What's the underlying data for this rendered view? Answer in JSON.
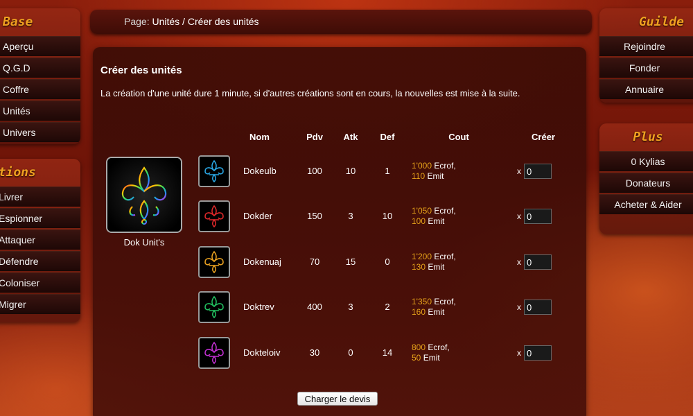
{
  "sidebar_left": {
    "base": {
      "title": "Base",
      "items": [
        {
          "label": "Aperçu"
        },
        {
          "label": "Q.G.D"
        },
        {
          "label": "Coffre"
        },
        {
          "label": "Unités"
        },
        {
          "label": "Univers"
        }
      ]
    },
    "actions": {
      "title": "Actions",
      "items": [
        {
          "label": "Livrer"
        },
        {
          "label": "Espionner"
        },
        {
          "label": "Attaquer"
        },
        {
          "label": "Défendre"
        },
        {
          "label": "Coloniser"
        },
        {
          "label": "Migrer"
        }
      ]
    }
  },
  "sidebar_right": {
    "guilde": {
      "title": "Guilde",
      "items": [
        {
          "label": "Rejoindre"
        },
        {
          "label": "Fonder"
        },
        {
          "label": "Annuaire"
        }
      ]
    },
    "plus": {
      "title": "Plus",
      "items": [
        {
          "label": "0 Kylias"
        },
        {
          "label": "Donateurs"
        },
        {
          "label": "Acheter & Aider"
        }
      ]
    }
  },
  "breadcrumb": {
    "label": "Page:",
    "path": "Unités / Créer des unités"
  },
  "main": {
    "title": "Créer des unités",
    "description": "La création d'une unité dure 1 minute, si d'autres créations sont en cours, la nouvelles est mise à la suite.",
    "portrait_name": "Dok Unit's",
    "columns": {
      "nom": "Nom",
      "pdv": "Pdv",
      "atk": "Atk",
      "def": "Def",
      "cout": "Cout",
      "creer": "Créer"
    },
    "units": [
      {
        "name": "Dokeulb",
        "pdv": "100",
        "atk": "10",
        "def": "1",
        "cost1_num": "1'000",
        "cost1_unit": "Ecrof,",
        "cost2_num": "110",
        "cost2_unit": "Emit",
        "x": "x",
        "qty": "0",
        "color": "#2aa8e6"
      },
      {
        "name": "Dokder",
        "pdv": "150",
        "atk": "3",
        "def": "10",
        "cost1_num": "1'050",
        "cost1_unit": "Ecrof,",
        "cost2_num": "100",
        "cost2_unit": "Emit",
        "x": "x",
        "qty": "0",
        "color": "#e0282a"
      },
      {
        "name": "Dokenuaj",
        "pdv": "70",
        "atk": "15",
        "def": "0",
        "cost1_num": "1'200",
        "cost1_unit": "Ecrof,",
        "cost2_num": "130",
        "cost2_unit": "Emit",
        "x": "x",
        "qty": "0",
        "color": "#e8a020"
      },
      {
        "name": "Doktrev",
        "pdv": "400",
        "atk": "3",
        "def": "2",
        "cost1_num": "1'350",
        "cost1_unit": "Ecrof,",
        "cost2_num": "160",
        "cost2_unit": "Emit",
        "x": "x",
        "qty": "0",
        "color": "#22c060"
      },
      {
        "name": "Dokteloiv",
        "pdv": "30",
        "atk": "0",
        "def": "14",
        "cost1_num": "800",
        "cost1_unit": "Ecrof,",
        "cost2_num": "50",
        "cost2_unit": "Emit",
        "x": "x",
        "qty": "0",
        "color": "#c030d0"
      }
    ],
    "submit_label": "Charger le devis"
  }
}
